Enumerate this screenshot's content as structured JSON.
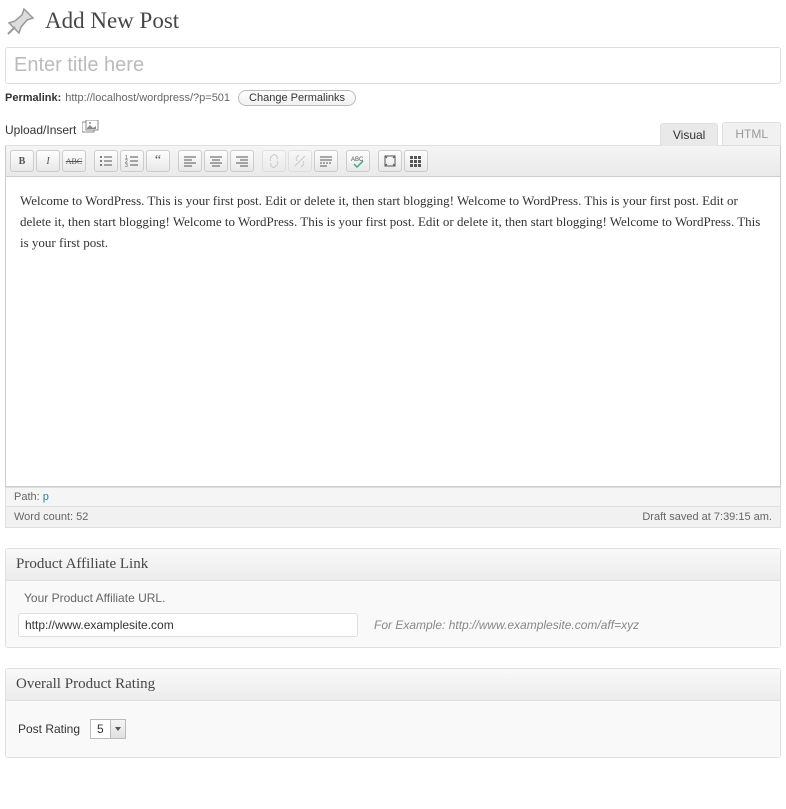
{
  "header": {
    "title": "Add New Post"
  },
  "title_input": {
    "placeholder": "Enter title here",
    "value": ""
  },
  "permalink": {
    "label": "Permalink:",
    "url": "http://localhost/wordpress/?p=501",
    "change_button": "Change Permalinks"
  },
  "media": {
    "upload_label": "Upload/Insert"
  },
  "tabs": {
    "visual": "Visual",
    "html": "HTML"
  },
  "editor": {
    "content": "Welcome to WordPress. This is your first post. Edit or delete it, then start blogging! Welcome to WordPress. This is your first post. Edit or delete it, then start blogging! Welcome to WordPress. This is your first post. Edit or delete it, then start blogging! Welcome to WordPress. This is your first post."
  },
  "path": {
    "label": "Path: ",
    "value": "p"
  },
  "footer": {
    "word_count_label": "Word count:",
    "word_count": "52",
    "draft_status": "Draft saved at 7:39:15 am."
  },
  "metabox_affiliate": {
    "title": "Product Affiliate Link",
    "description": "Your Product Affiliate URL.",
    "value": "http://www.examplesite.com",
    "example": "For Example: http://www.examplesite.com/aff=xyz"
  },
  "metabox_rating": {
    "title": "Overall Product Rating",
    "label": "Post Rating",
    "value": "5"
  }
}
